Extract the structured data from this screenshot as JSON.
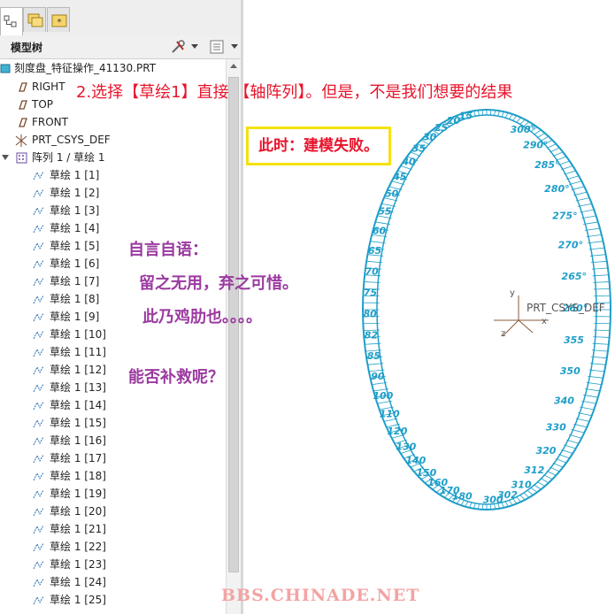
{
  "tabs": [
    {
      "name": "model-tree-tab-icon",
      "active": true
    },
    {
      "name": "folder-browser-tab-icon",
      "active": false
    },
    {
      "name": "favorites-tab-icon",
      "active": false
    }
  ],
  "panel": {
    "title": "模型树",
    "settings_icon": "tools-icon",
    "filter_icon": "tree-columns-icon"
  },
  "tree": {
    "part_name": "刻度盘_特征操作_41130.PRT",
    "datum_planes": [
      "RIGHT",
      "TOP",
      "FRONT"
    ],
    "csys": "PRT_CSYS_DEF",
    "pattern": "阵列 1 / 草绘 1",
    "sketch_prefix": "草绘 1",
    "sketch_items": [
      "[1]",
      "[2]",
      "[3]",
      "[4]",
      "[5]",
      "[6]",
      "[7]",
      "[8]",
      "[9]",
      "[10]",
      "[11]",
      "[12]",
      "[13]",
      "[14]",
      "[15]",
      "[16]",
      "[17]",
      "[18]",
      "[19]",
      "[20]",
      "[21]",
      "[22]",
      "[23]",
      "[24]",
      "[25]"
    ]
  },
  "annotations": {
    "step": "2.选择【草绘1】直接 【轴阵列】。但是，不是我们想要的结果",
    "fail": "此时：建模失败。",
    "monologue_title": "自言自语：",
    "monologue_line1": "留之无用，弃之可惜。",
    "monologue_line2": "此乃鸡肋也。。。。",
    "question": "能否补救呢？"
  },
  "viewport": {
    "csys_label": "PRT_CSYS_DEF",
    "axis_labels": [
      "y",
      "x",
      "z"
    ],
    "ring_labels_right": [
      "300°",
      "290°",
      "285°",
      "280°",
      "275°",
      "270°",
      "265°",
      "260°",
      "355",
      "350",
      "340",
      "330",
      "320",
      "312",
      "310",
      "302",
      "300"
    ],
    "ring_labels_left": [
      "15",
      "20",
      "25",
      "30",
      "35",
      "40",
      "45",
      "50",
      "55",
      "60",
      "65",
      "70",
      "75",
      "80",
      "82",
      "85",
      "90",
      "100",
      "110",
      "120",
      "130",
      "140",
      "150",
      "160",
      "170",
      "180"
    ],
    "ring_color": "#1e9ec8"
  },
  "watermark": "BBS.CHINADE.NET"
}
